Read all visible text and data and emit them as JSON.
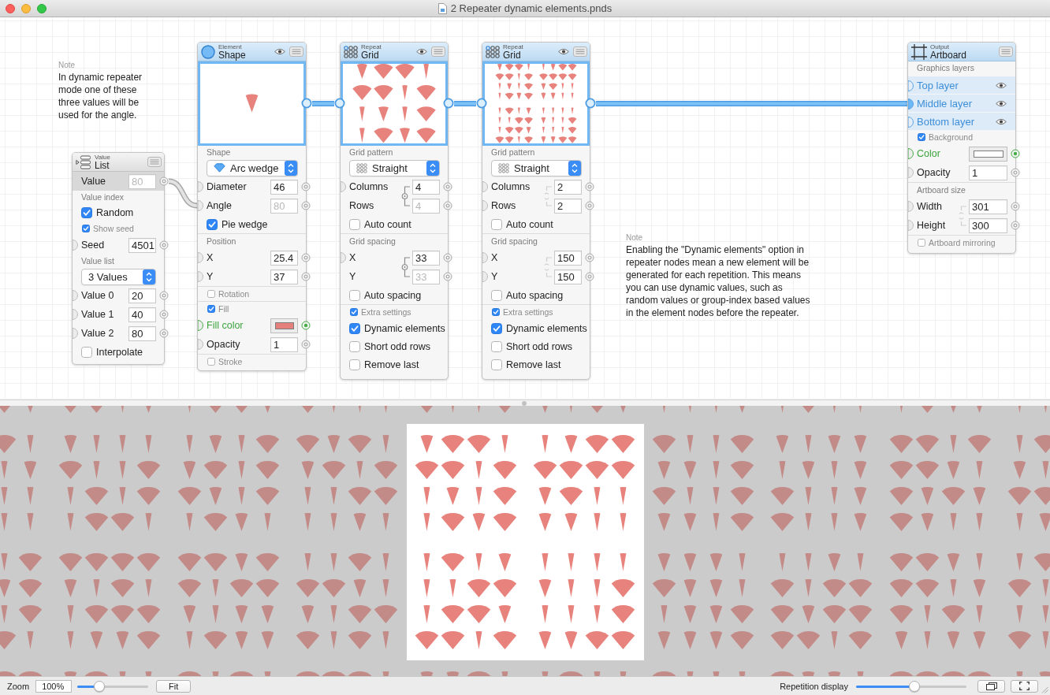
{
  "window": {
    "title": "2 Repeater dynamic elements.pnds"
  },
  "notes": [
    {
      "label": "Note",
      "text": "In dynamic repeater mode one of these three values will be used for the angle."
    },
    {
      "label": "Note",
      "text": "Enabling the \"Dynamic elements\" option in repeater nodes mean a new element will be generated for each repetition. This means you can use dynamic values, such as random values or group-index based values in the element nodes before the repeater."
    }
  ],
  "nodes": [
    {
      "kind": "value",
      "category": "Value",
      "title": "List",
      "selected": false,
      "rows": [
        {
          "kind": "result",
          "label": "Value",
          "value": "80",
          "disabled": true
        },
        {
          "kind": "section",
          "label": "Value index"
        },
        {
          "kind": "check",
          "label": "Random",
          "checked": true
        },
        {
          "kind": "small_check",
          "label": "Show seed",
          "checked": true
        },
        {
          "kind": "number",
          "label": "Seed",
          "value": "4501",
          "disabled": false
        },
        {
          "kind": "section",
          "label": "Value list"
        },
        {
          "kind": "select",
          "value": "3 Values"
        },
        {
          "kind": "number",
          "label": "Value 0",
          "value": "20",
          "disabled": false
        },
        {
          "kind": "number",
          "label": "Value 1",
          "value": "40",
          "disabled": false
        },
        {
          "kind": "number",
          "label": "Value 2",
          "value": "80",
          "disabled": false
        },
        {
          "kind": "check",
          "label": "Interpolate",
          "checked": false
        }
      ]
    },
    {
      "kind": "element",
      "category": "Element",
      "title": "Shape",
      "selected": true,
      "rows": [
        {
          "kind": "section",
          "label": "Shape"
        },
        {
          "kind": "select",
          "value": "Arc wedge"
        },
        {
          "kind": "number",
          "label": "Diameter",
          "value": "46",
          "disabled": false
        },
        {
          "kind": "number",
          "label": "Angle",
          "value": "80",
          "disabled": true
        },
        {
          "kind": "check",
          "label": "Pie wedge",
          "checked": true
        },
        {
          "kind": "divider"
        },
        {
          "kind": "section",
          "label": "Position"
        },
        {
          "kind": "number",
          "label": "X",
          "value": "25.4",
          "disabled": false
        },
        {
          "kind": "number",
          "label": "Y",
          "value": "37",
          "disabled": false
        },
        {
          "kind": "divider"
        },
        {
          "kind": "small_check",
          "label": "Rotation",
          "checked": false
        },
        {
          "kind": "divider"
        },
        {
          "kind": "small_check",
          "label": "Fill",
          "checked": true
        },
        {
          "kind": "color",
          "label": "Fill color",
          "color": "#e57f7b"
        },
        {
          "kind": "number",
          "label": "Opacity",
          "value": "1",
          "disabled": false
        },
        {
          "kind": "divider"
        },
        {
          "kind": "small_check",
          "label": "Stroke",
          "checked": false
        }
      ]
    },
    {
      "kind": "repeat",
      "category": "Repeat",
      "title": "Grid",
      "selected": true,
      "rows": [
        {
          "kind": "section",
          "label": "Grid pattern"
        },
        {
          "kind": "select",
          "value": "Straight"
        },
        {
          "kind": "pair",
          "linked": true,
          "rows": [
            {
              "label": "Columns",
              "value": "4",
              "disabled": false
            },
            {
              "label": "Rows",
              "value": "4",
              "disabled": true
            }
          ]
        },
        {
          "kind": "check",
          "label": "Auto count",
          "checked": false
        },
        {
          "kind": "divider"
        },
        {
          "kind": "section",
          "label": "Grid spacing"
        },
        {
          "kind": "pair",
          "linked": true,
          "rows": [
            {
              "label": "X",
              "value": "33",
              "disabled": false
            },
            {
              "label": "Y",
              "value": "33",
              "disabled": true
            }
          ]
        },
        {
          "kind": "check",
          "label": "Auto spacing",
          "checked": false
        },
        {
          "kind": "divider"
        },
        {
          "kind": "small_check",
          "label": "Extra settings",
          "checked": true
        },
        {
          "kind": "check",
          "label": "Dynamic elements",
          "checked": true
        },
        {
          "kind": "check",
          "label": "Short odd rows",
          "checked": false
        },
        {
          "kind": "check",
          "label": "Remove last",
          "checked": false
        }
      ]
    },
    {
      "kind": "repeat",
      "category": "Repeat",
      "title": "Grid",
      "selected": true,
      "rows": [
        {
          "kind": "section",
          "label": "Grid pattern"
        },
        {
          "kind": "select",
          "value": "Straight"
        },
        {
          "kind": "pair",
          "linked": false,
          "rows": [
            {
              "label": "Columns",
              "value": "2",
              "disabled": false
            },
            {
              "label": "Rows",
              "value": "2",
              "disabled": false
            }
          ]
        },
        {
          "kind": "check",
          "label": "Auto count",
          "checked": false
        },
        {
          "kind": "divider"
        },
        {
          "kind": "section",
          "label": "Grid spacing"
        },
        {
          "kind": "pair",
          "linked": false,
          "rows": [
            {
              "label": "X",
              "value": "150",
              "disabled": false
            },
            {
              "label": "Y",
              "value": "150",
              "disabled": false
            }
          ]
        },
        {
          "kind": "check",
          "label": "Auto spacing",
          "checked": false
        },
        {
          "kind": "divider"
        },
        {
          "kind": "small_check",
          "label": "Extra settings",
          "checked": true
        },
        {
          "kind": "check",
          "label": "Dynamic elements",
          "checked": true
        },
        {
          "kind": "check",
          "label": "Short odd rows",
          "checked": false
        },
        {
          "kind": "check",
          "label": "Remove last",
          "checked": false
        }
      ]
    },
    {
      "kind": "output",
      "category": "Output",
      "title": "Artboard",
      "selected": true,
      "rows": [
        {
          "kind": "section",
          "label": "Graphics layers"
        },
        {
          "kind": "layer",
          "label": "Top layer",
          "connected": false
        },
        {
          "kind": "layer",
          "label": "Middle layer",
          "connected": true
        },
        {
          "kind": "layer",
          "label": "Bottom layer",
          "connected": false
        },
        {
          "kind": "small_check",
          "label": "Background",
          "checked": true
        },
        {
          "kind": "color",
          "label": "Color",
          "color": "#ffffff"
        },
        {
          "kind": "number",
          "label": "Opacity",
          "value": "1",
          "disabled": false
        },
        {
          "kind": "divider"
        },
        {
          "kind": "section",
          "label": "Artboard size"
        },
        {
          "kind": "pair",
          "linked": false,
          "rows": [
            {
              "label": "Width",
              "value": "301",
              "disabled": false
            },
            {
              "label": "Height",
              "value": "300",
              "disabled": false
            }
          ]
        },
        {
          "kind": "divider"
        },
        {
          "kind": "small_check",
          "label": "Artboard mirroring",
          "checked": false
        }
      ]
    }
  ],
  "status_bar": {
    "zoom_label": "Zoom",
    "zoom_value": "100%",
    "zoom_slider": {
      "level": 0.28
    },
    "fit_button": "Fit",
    "repetition_label": "Repetition display",
    "repetition_slider": {
      "level": 0.53
    }
  }
}
